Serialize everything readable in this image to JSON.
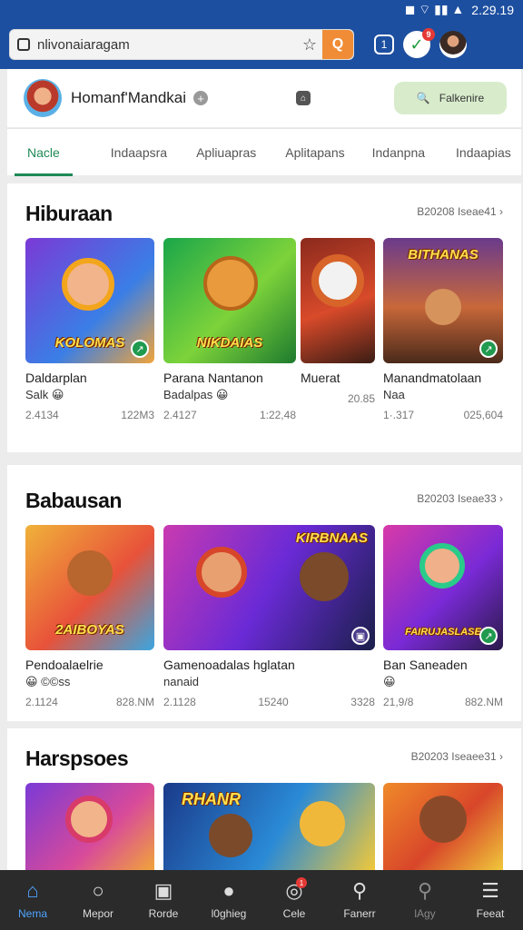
{
  "status": {
    "time": "2.29.19"
  },
  "browser": {
    "url": "nlivonaiaragam",
    "orange_label": "Q"
  },
  "profile": {
    "name": "Homanf'Mandkai",
    "button_label": "Falkenire"
  },
  "tabs": [
    "Nacle",
    "Indaapsra",
    "Apliuapras",
    "Aplitapans",
    "Indanpna",
    "Indaapias"
  ],
  "sections": [
    {
      "title": "Hiburaan",
      "more": "B20208 Iseae41",
      "cards": [
        {
          "title": "Daldarplan",
          "subtitle": "Salk 😀",
          "rating": "2.4134",
          "size": "122M3",
          "banner": "KOLOMAS"
        },
        {
          "title": "Parana Nantanon",
          "subtitle": "Badalpas 😀",
          "rating": "2.4127",
          "size": "1:22,48",
          "banner": "NIKDAIAS"
        },
        {
          "title": "Muerat",
          "subtitle": "",
          "rating": "",
          "size": "20.85",
          "banner": ""
        },
        {
          "title": "Manandmatolaan",
          "subtitle": "Naa",
          "rating": "1·.317",
          "size": "025,604",
          "banner": "BITHANAS"
        }
      ]
    },
    {
      "title": "Babausan",
      "more": "B20203 Iseae33",
      "cards": [
        {
          "title": "Pendoalaelrie",
          "subtitle": "😀 ©©ss",
          "rating": "2.1124",
          "size": "828.NM",
          "banner": "2AIBOYAS"
        },
        {
          "title": "Gamenoadalas hglatan",
          "subtitle": "nanaid",
          "rating": "2.1128",
          "size": "15240",
          "extra": "3328",
          "banner": "KIRBNAAS"
        },
        {
          "title": "Ban Saneaden",
          "subtitle": "😀",
          "rating": "21,9/8",
          "size": "882.NM",
          "banner": "FAIRUJASLASE"
        }
      ]
    },
    {
      "title": "Harspsoes",
      "more": "B20203 Iseaee31",
      "cards": [
        {
          "banner": ""
        },
        {
          "banner": "RHANR"
        },
        {
          "banner": ""
        }
      ]
    }
  ],
  "nav": [
    {
      "label": "Nema",
      "icon": "home-icon"
    },
    {
      "label": "Mepor",
      "icon": "circle-icon"
    },
    {
      "label": "Rorde",
      "icon": "briefcase-icon"
    },
    {
      "label": "l0ghieg",
      "icon": "chat-icon"
    },
    {
      "label": "Cele",
      "icon": "compass-icon"
    },
    {
      "label": "Fanerr",
      "icon": "search-icon"
    },
    {
      "label": "lAgy",
      "icon": "search-icon"
    },
    {
      "label": "Feeat",
      "icon": "menu-icon"
    }
  ],
  "colors": {
    "brand": "#1d4fa0",
    "accent": "#1e8a55",
    "nav_active": "#4ea3ff"
  }
}
